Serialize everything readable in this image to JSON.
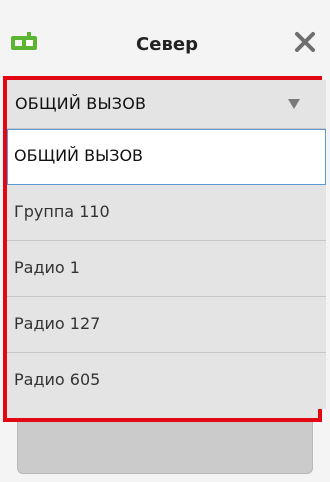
{
  "header": {
    "title": "Север",
    "radio_icon": "radio-icon",
    "close_icon": "close-icon"
  },
  "colors": {
    "highlight_frame": "#e30613",
    "radio_icon": "#5cb531",
    "selected_border": "#5a9bd5"
  },
  "dropdown": {
    "selected_value": "ОБЩИЙ ВЫЗОВ",
    "arrow_icon": "triangle-down-icon",
    "options": [
      "ОБЩИЙ ВЫЗОВ",
      "Группа 110",
      "Радио 1",
      "Радио 127",
      "Радио 605"
    ]
  }
}
